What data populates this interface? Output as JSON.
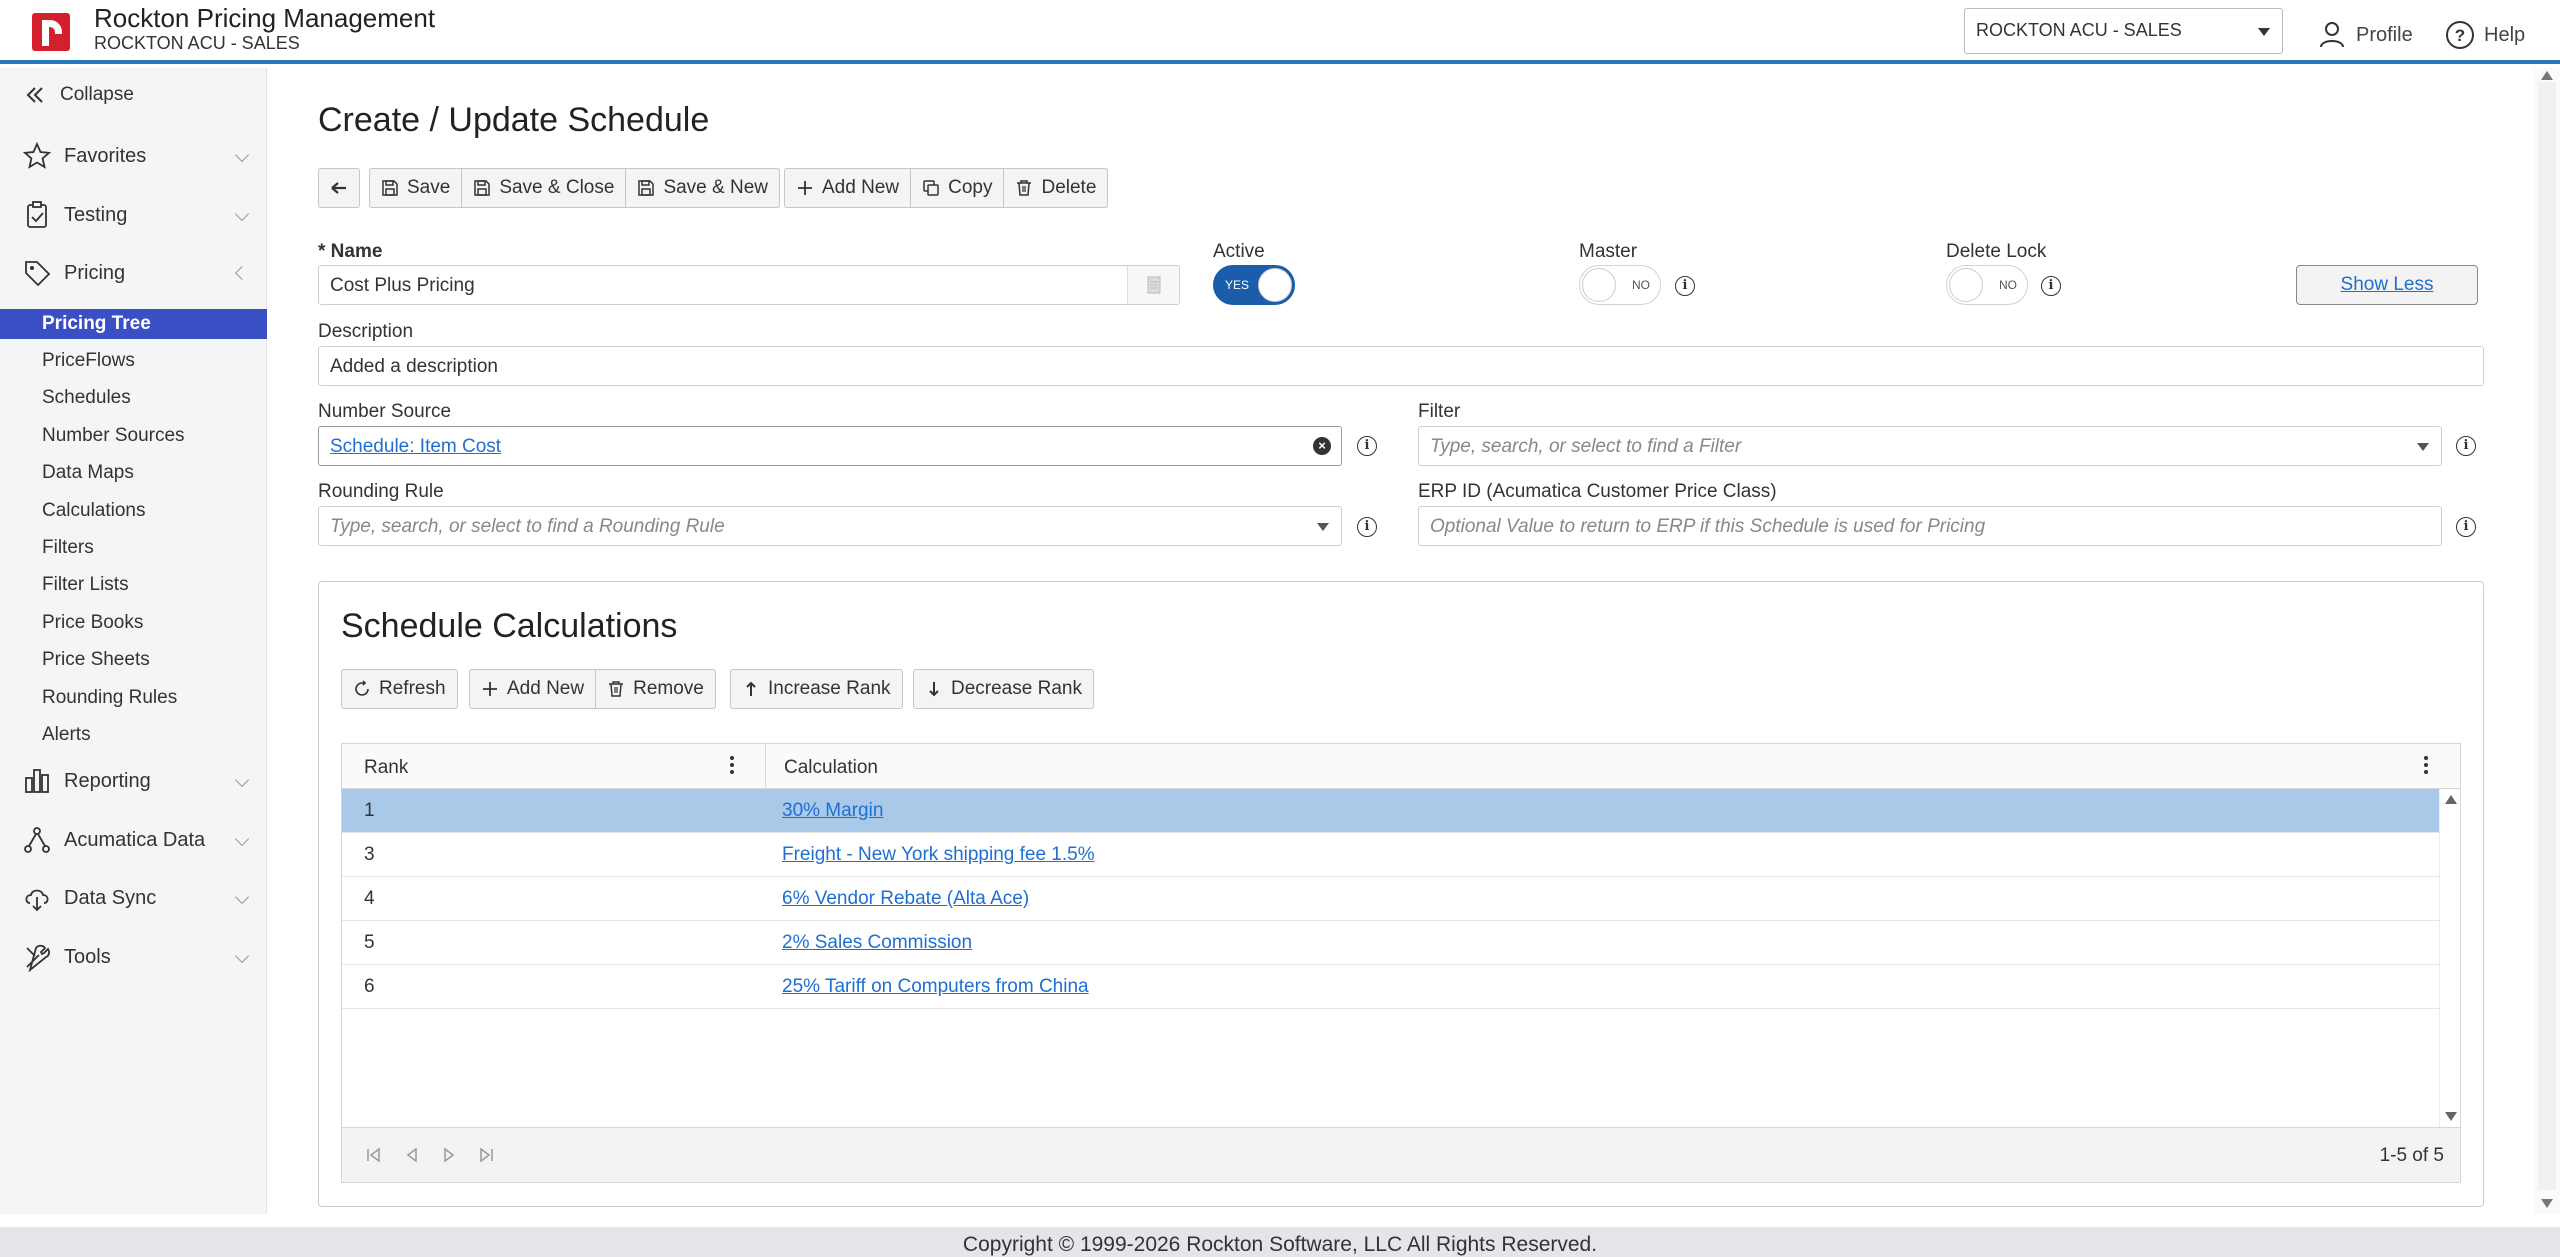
{
  "header": {
    "app_title": "Rockton Pricing Management",
    "app_subtitle": "ROCKTON ACU - SALES",
    "company_selected": "ROCKTON ACU - SALES",
    "profile_label": "Profile",
    "help_label": "Help",
    "accent_color": "#2779bd",
    "logo_color": "#d4202c"
  },
  "sidebar": {
    "collapse_label": "Collapse",
    "groups": {
      "favorites": "Favorites",
      "testing": "Testing",
      "pricing": "Pricing",
      "reporting": "Reporting",
      "acumatica": "Acumatica Data",
      "datasync": "Data Sync",
      "tools": "Tools"
    },
    "items": [
      "Pricing Tree",
      "PriceFlows",
      "Schedules",
      "Number Sources",
      "Data Maps",
      "Calculations",
      "Filters",
      "Filter Lists",
      "Price Books",
      "Price Sheets",
      "Rounding Rules",
      "Alerts"
    ],
    "active_color": "#3b4fc4"
  },
  "page": {
    "title": "Create / Update Schedule",
    "toolbar": {
      "back_icon": "arrow-left-icon",
      "save": "Save",
      "save_close": "Save & Close",
      "save_new": "Save & New",
      "add_new": "Add New",
      "copy": "Copy",
      "delete": "Delete"
    }
  },
  "form": {
    "name_label": "* Name",
    "name_value": "Cost Plus Pricing",
    "active_label": "Active",
    "active_value": "YES",
    "master_label": "Master",
    "master_value": "NO",
    "delete_lock_label": "Delete Lock",
    "delete_lock_value": "NO",
    "show_less": "Show Less",
    "description_label": "Description",
    "description_value": "Added a description",
    "number_source_label": "Number Source",
    "number_source_value": "Schedule: Item Cost",
    "filter_label": "Filter",
    "filter_placeholder": "Type, search, or select to find a Filter",
    "rounding_label": "Rounding Rule",
    "rounding_placeholder": "Type, search, or select to find a Rounding Rule",
    "erp_label": "ERP ID (Acumatica Customer Price Class)",
    "erp_placeholder": "Optional Value to return to ERP if this Schedule is used for Pricing"
  },
  "calculations": {
    "title": "Schedule Calculations",
    "buttons": {
      "refresh": "Refresh",
      "add_new": "Add New",
      "remove": "Remove",
      "increase_rank": "Increase Rank",
      "decrease_rank": "Decrease Rank"
    },
    "columns": [
      "Rank",
      "Calculation"
    ],
    "rows": [
      {
        "rank": "1",
        "calculation": "30% Margin",
        "selected": true
      },
      {
        "rank": "3",
        "calculation": "Freight - New York shipping fee 1.5%",
        "selected": false
      },
      {
        "rank": "4",
        "calculation": "6% Vendor Rebate (Alta Ace)",
        "selected": false
      },
      {
        "rank": "5",
        "calculation": "2% Sales Commission",
        "selected": false
      },
      {
        "rank": "6",
        "calculation": "25% Tariff on Computers from China",
        "selected": false
      }
    ],
    "pager_text": "1-5 of 5",
    "selected_color": "#a9c9e9"
  },
  "footer": {
    "copyright": "Copyright © 1999-2026 Rockton Software, LLC All Rights Reserved."
  }
}
